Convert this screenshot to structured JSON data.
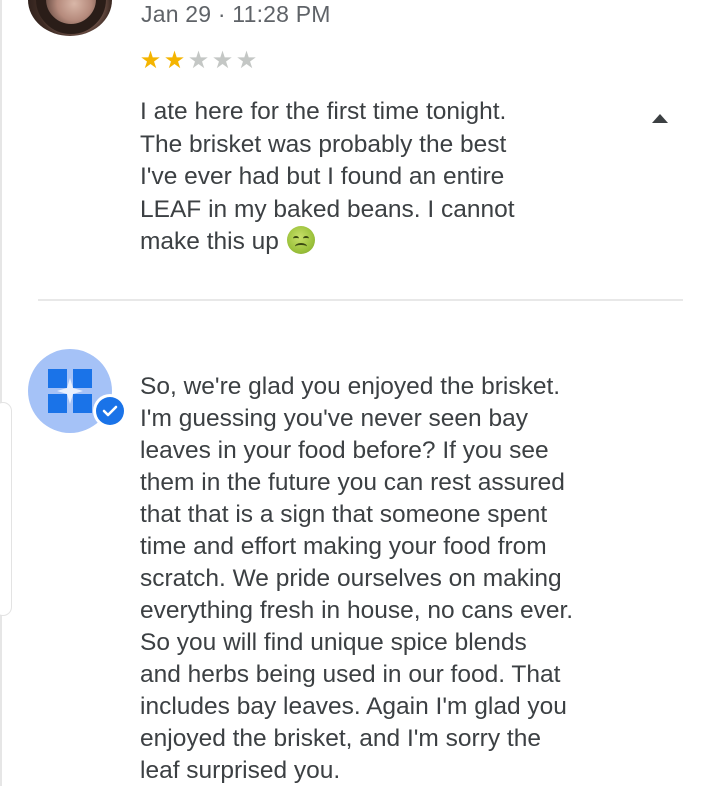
{
  "review": {
    "date": "Jan 29 · 11:28 PM",
    "rating": 2,
    "max_rating": 5,
    "text": "I ate here for the first time tonight.\nThe brisket was probably the best\nI've ever had but I found an entire\nLEAF in my baked beans. I cannot\nmake this up",
    "emoji": "nauseated-face-emoji",
    "star_filled_color": "#f4b400",
    "star_empty_color": "#c4c7c5"
  },
  "owner_reply": {
    "verified": true,
    "badge_color": "#1a73e8",
    "avatar_color": "#a5c2f7",
    "text": "So, we're glad you enjoyed the brisket.\nI'm guessing you've never seen bay\nleaves in your food before? If you see\nthem in the future you can rest assured\nthat that is a sign that someone spent\ntime and effort making your food from\nscratch. We pride ourselves on making\neverything fresh in house, no cans ever.\nSo you will find unique spice blends\nand herbs being used in our food. That\nincludes bay leaves. Again I'm glad you\nenjoyed the brisket, and I'm sorry the\nleaf surprised you."
  },
  "icons": {
    "collapse": "collapse-triangle-icon",
    "verified": "verified-check-icon",
    "star": "star-icon"
  }
}
